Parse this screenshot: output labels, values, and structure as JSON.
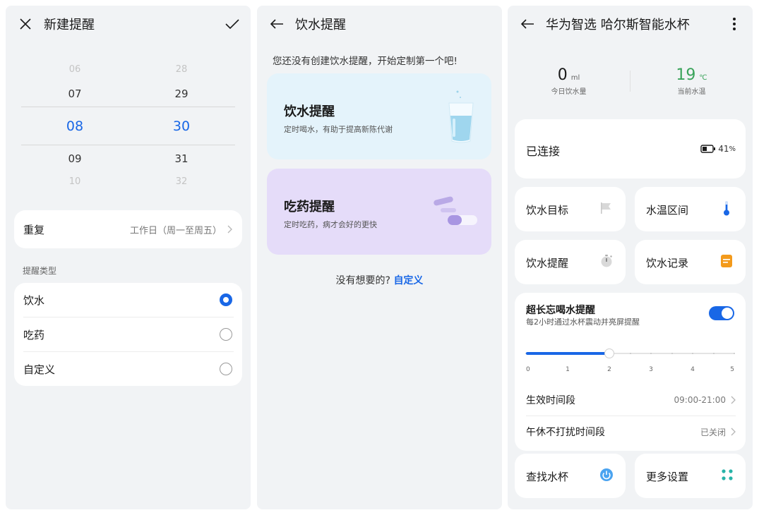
{
  "panel1": {
    "title": "新建提醒",
    "picker": {
      "hours": [
        "06",
        "07",
        "08",
        "09",
        "10"
      ],
      "minutes": [
        "28",
        "29",
        "30",
        "31",
        "32"
      ]
    },
    "repeat": {
      "label": "重复",
      "value": "工作日（周一至周五）"
    },
    "type_section_label": "提醒类型",
    "types": [
      {
        "label": "饮水",
        "selected": true
      },
      {
        "label": "吃药",
        "selected": false
      },
      {
        "label": "自定义",
        "selected": false
      }
    ]
  },
  "panel2": {
    "title": "饮水提醒",
    "intro": "您还没有创建饮水提醒，开始定制第一个吧!",
    "cards": [
      {
        "title": "饮水提醒",
        "subtitle": "定时喝水，有助于提高新陈代谢"
      },
      {
        "title": "吃药提醒",
        "subtitle": "定时吃药，病才会好的更快"
      }
    ],
    "footer_prefix": "没有想要的?",
    "footer_link": "自定义"
  },
  "panel3": {
    "title": "华为智选 哈尔斯智能水杯",
    "stats": {
      "intake_value": "0",
      "intake_unit": "ml",
      "intake_label": "今日饮水量",
      "temp_value": "19",
      "temp_unit": "℃",
      "temp_label": "当前水温"
    },
    "connection": {
      "label": "已连接",
      "battery": "41",
      "battery_unit": "%"
    },
    "tiles": [
      {
        "label": "饮水目标",
        "icon": "flag-icon"
      },
      {
        "label": "水温区间",
        "icon": "thermometer-icon"
      },
      {
        "label": "饮水提醒",
        "icon": "timer-icon"
      },
      {
        "label": "饮水记录",
        "icon": "record-icon"
      }
    ],
    "long_reminder": {
      "title": "超长忘喝水提醒",
      "subtitle": "每2小时通过水杯震动并亮屏提醒",
      "enabled": true,
      "slider_value": 2,
      "scale": [
        "0",
        "1",
        "2",
        "3",
        "4",
        "5"
      ],
      "active_period_label": "生效时间段",
      "active_period_value": "09:00-21:00",
      "nap_label": "午休不打扰时间段",
      "nap_value": "已关闭"
    },
    "bottom_tiles": [
      {
        "label": "查找水杯",
        "icon": "power-icon"
      },
      {
        "label": "更多设置",
        "icon": "dots-grid-icon"
      }
    ],
    "colors": {
      "accent": "#1967e6",
      "temp": "#3aa35a",
      "record": "#f39a1b"
    }
  }
}
